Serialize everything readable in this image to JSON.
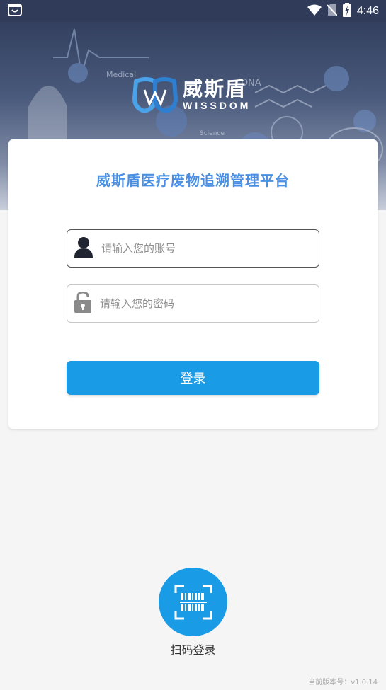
{
  "status_bar": {
    "time": "4:46",
    "icons": [
      "app-notification-icon",
      "wifi-icon",
      "no-sim-icon",
      "battery-charging-icon"
    ]
  },
  "banner": {
    "logo_cn": "威斯盾",
    "logo_en": "WISSDOM",
    "deco_words": [
      "Medical",
      "DNA",
      "Science"
    ]
  },
  "login": {
    "title": "威斯盾医疗废物追溯管理平台",
    "username_placeholder": "请输入您的账号",
    "password_placeholder": "请输入您的密码",
    "login_label": "登录"
  },
  "scan": {
    "label": "扫码登录"
  },
  "footer": {
    "version": "当前版本号：v1.0.14"
  },
  "colors": {
    "accent": "#1a9be6",
    "title": "#4a90e2",
    "header": "#2f3b58"
  }
}
